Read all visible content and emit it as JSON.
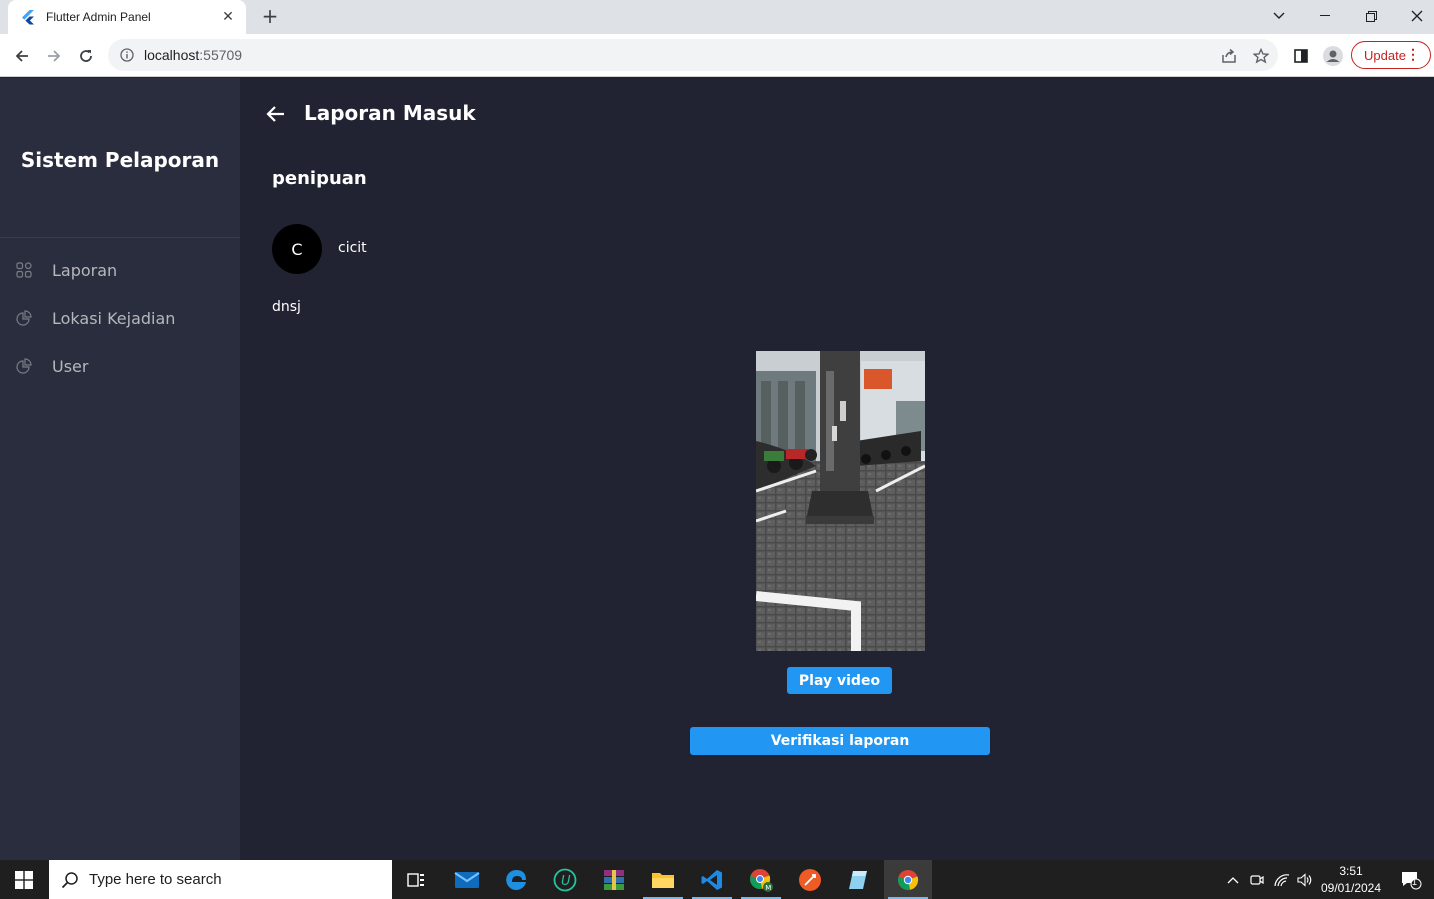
{
  "browser": {
    "tab_title": "Flutter Admin Panel",
    "url_host": "localhost",
    "url_port": ":55709",
    "update_label": "Update"
  },
  "sidebar": {
    "brand": "Sistem Pelaporan",
    "items": [
      {
        "label": "Laporan",
        "icon": "grid-icon"
      },
      {
        "label": "Lokasi Kejadian",
        "icon": "pie-icon"
      },
      {
        "label": "User",
        "icon": "pie-icon"
      }
    ]
  },
  "main": {
    "page_title": "Laporan Masuk",
    "report_title": "penipuan",
    "avatar_initial": "C",
    "username": "cicit",
    "description": "dnsj",
    "play_video_label": "Play video",
    "verify_label": "Verifikasi laporan"
  },
  "taskbar": {
    "search_placeholder": "Type here to search",
    "time": "3:51",
    "date": "09/01/2024",
    "notification_count": "1"
  },
  "colors": {
    "sidebar_bg": "#2a2d3e",
    "main_bg": "#212332",
    "primary": "#2196f3"
  }
}
